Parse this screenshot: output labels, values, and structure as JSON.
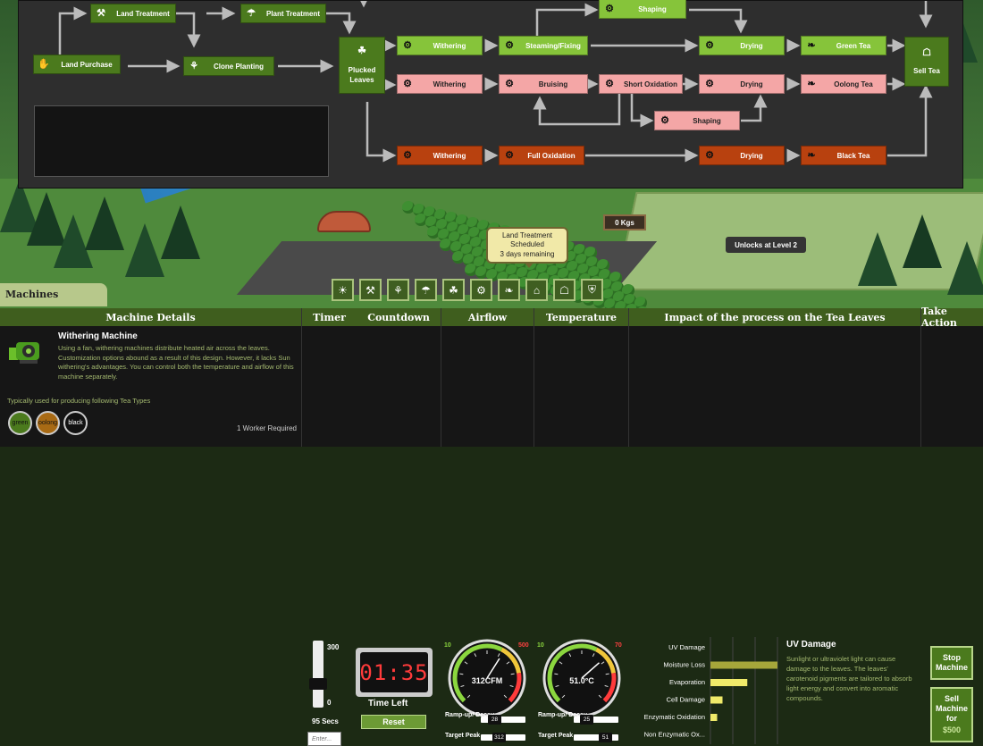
{
  "flow": {
    "nodes": {
      "land_purchase": {
        "label": "Land Purchase",
        "icon": "hand-leaf-icon"
      },
      "land_treatment": {
        "label": "Land Treatment",
        "icon": "shovel-icon"
      },
      "clone_planting": {
        "label": "Clone Planting",
        "icon": "sprout-icon"
      },
      "plant_treatment": {
        "label": "Plant Treatment",
        "icon": "watering-can-icon"
      },
      "plucked_leaves": {
        "label": "Plucked Leaves",
        "icon": "plucking-hand-icon"
      },
      "green_withering": {
        "label": "Withering",
        "icon": "gears-icon"
      },
      "steaming": {
        "label": "Steaming/Fixing",
        "icon": "gears-icon"
      },
      "green_shaping": {
        "label": "Shaping",
        "icon": "gears-icon"
      },
      "green_drying": {
        "label": "Drying",
        "icon": "gears-icon"
      },
      "green_tea": {
        "label": "Green Tea",
        "icon": "tea-leaf-icon"
      },
      "oolong_withering": {
        "label": "Withering",
        "icon": "gears-icon"
      },
      "bruising": {
        "label": "Bruising",
        "icon": "gears-icon"
      },
      "short_oxidation": {
        "label": "Short Oxidation",
        "icon": "gears-icon"
      },
      "oolong_shaping": {
        "label": "Shaping",
        "icon": "gears-icon"
      },
      "oolong_drying": {
        "label": "Drying",
        "icon": "gears-icon"
      },
      "oolong_tea": {
        "label": "Oolong Tea",
        "icon": "tea-leaf-icon"
      },
      "black_withering": {
        "label": "Withering",
        "icon": "gears-icon"
      },
      "full_oxidation": {
        "label": "Full Oxidation",
        "icon": "gears-icon"
      },
      "black_drying": {
        "label": "Drying",
        "icon": "gears-icon"
      },
      "black_tea": {
        "label": "Black Tea",
        "icon": "tea-leaf-icon"
      },
      "sell_tea": {
        "label": "Sell Tea",
        "icon": "chart-icon"
      }
    }
  },
  "scene": {
    "tooltip_line1": "Land Treatment Scheduled",
    "tooltip_line2": "3 days remaining",
    "storage": "0 Kgs",
    "unlock": "Unlocks at Level 2"
  },
  "machines_tab": "Machines",
  "toolbar_icons": [
    "sun-leaf-icon",
    "shovel-icon",
    "sprout-icon",
    "watering-can-icon",
    "plucking-hand-icon",
    "gears-icon",
    "tea-leaf-icon",
    "house-icon",
    "chart-icon",
    "shield-icon"
  ],
  "details": {
    "header": "Machine Details",
    "title": "Withering Machine",
    "description": "Using a fan, withering machines distribute heated air across the leaves. Customization options abound as a result of this design. However, it lacks Sun withering's advantages. You can control both the temperature and airflow of this machine separately.",
    "typical_label": "Typically used for producing following Tea Types",
    "tea_types": [
      {
        "label": "green",
        "color": "#4b7a1d"
      },
      {
        "label": "oolong",
        "color": "#a86a14"
      },
      {
        "label": "black",
        "color": "#111111"
      }
    ],
    "worker": "1 Worker Required"
  },
  "timer": {
    "header": "Timer",
    "max": "300",
    "min": "0",
    "value": "95 Secs",
    "level": 0.32,
    "input_placeholder": "Enter..."
  },
  "countdown": {
    "header": "Countdown",
    "display": "01:35",
    "label": "Time Left",
    "reset": "Reset"
  },
  "airflow": {
    "header": "Airflow",
    "min": "10",
    "max": "500",
    "reading": "312CFM",
    "needle_fraction": 0.62,
    "ramp_label": "Ramp-up/ Decay",
    "ramp_value": "28",
    "target_label": "Target Peak",
    "target_value": "312"
  },
  "temperature": {
    "header": "Temperature",
    "min": "10",
    "max": "70",
    "reading": "51.0°C",
    "needle_fraction": 0.68,
    "ramp_label": "Ramp-up/ Decay",
    "ramp_value": "25",
    "target_label": "Target Peak",
    "target_value": "51"
  },
  "impact": {
    "header": "Impact of the process on the Tea Leaves",
    "side_title": "UV Damage",
    "side_desc": "Sunlight or ultraviolet light can cause damage to the leaves. The leaves' carotenoid pigments are tailored to absorb light energy and convert into aromatic compounds.",
    "colors": {
      "uv": "#a6a63a",
      "bright": "#f0ea6a"
    }
  },
  "chart_data": {
    "type": "bar",
    "orientation": "horizontal",
    "categories": [
      "UV Damage",
      "Moisture Loss",
      "Evaporation",
      "Cell Damage",
      "Enzymatic Oxidation",
      "Non Enzymatic Ox..."
    ],
    "values": [
      0,
      1.0,
      0.55,
      0.18,
      0.1,
      0
    ],
    "colors": [
      "#a6a63a",
      "#a6a63a",
      "#f0ea6a",
      "#f0ea6a",
      "#f0ea6a",
      "#f0ea6a"
    ],
    "title": "Impact of the process on the Tea Leaves",
    "xlim": [
      0,
      1
    ],
    "grid": true
  },
  "action": {
    "header": "Take Action",
    "stop": "Stop Machine",
    "sell": "Sell Machine for",
    "price": "$500"
  }
}
